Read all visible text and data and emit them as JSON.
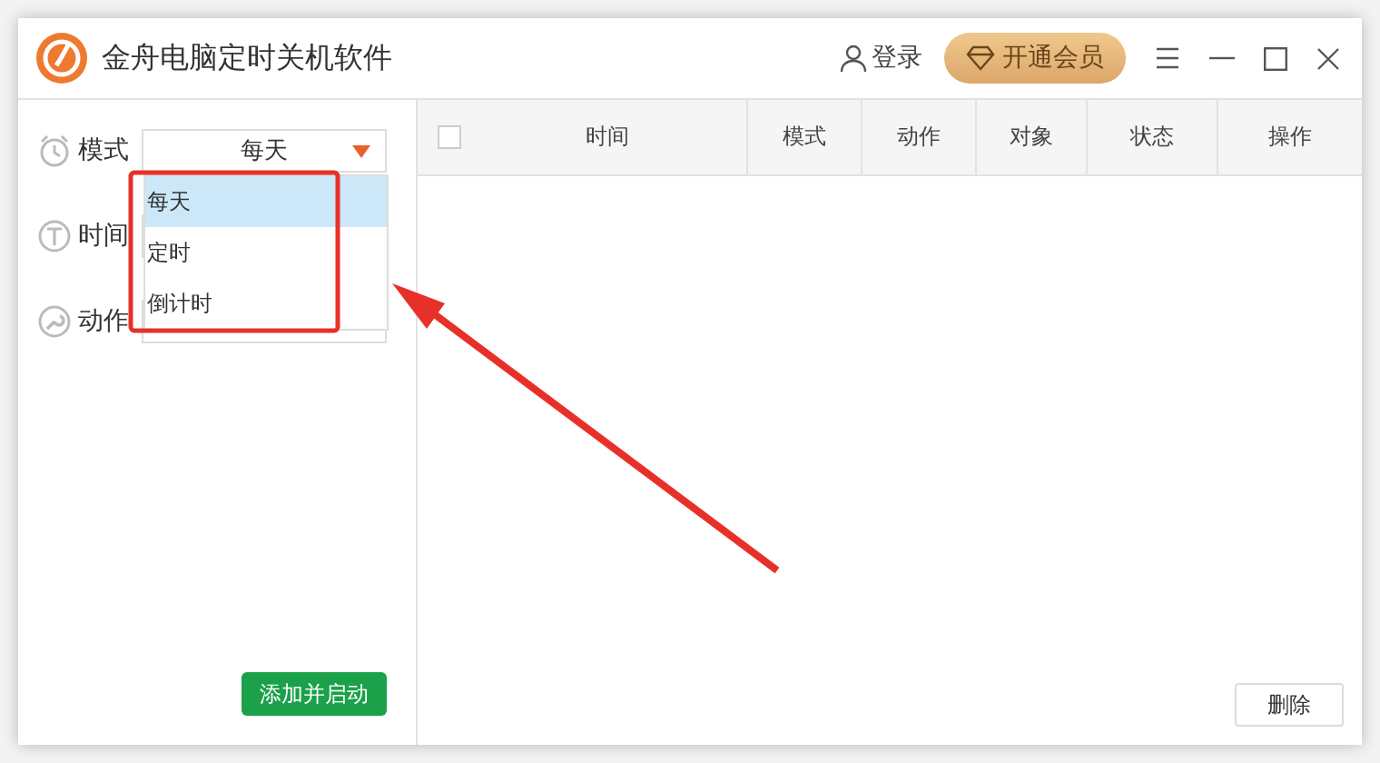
{
  "window": {
    "title": "金舟电脑定时关机软件"
  },
  "header": {
    "login": "登录",
    "vip_button": "开通会员"
  },
  "form": {
    "fields": [
      {
        "label": "模式",
        "value": "每天"
      },
      {
        "label": "时间"
      },
      {
        "label": "动作"
      }
    ],
    "dropdown": {
      "options": [
        {
          "label": "每天",
          "selected": true
        },
        {
          "label": "定时",
          "selected": false
        },
        {
          "label": "倒计时",
          "selected": false
        }
      ]
    },
    "submit_button": "添加并启动"
  },
  "table": {
    "select_all_checked": false,
    "columns": [
      "时间",
      "模式",
      "动作",
      "对象",
      "状态",
      "操作"
    ]
  },
  "delete_button": "删除"
}
